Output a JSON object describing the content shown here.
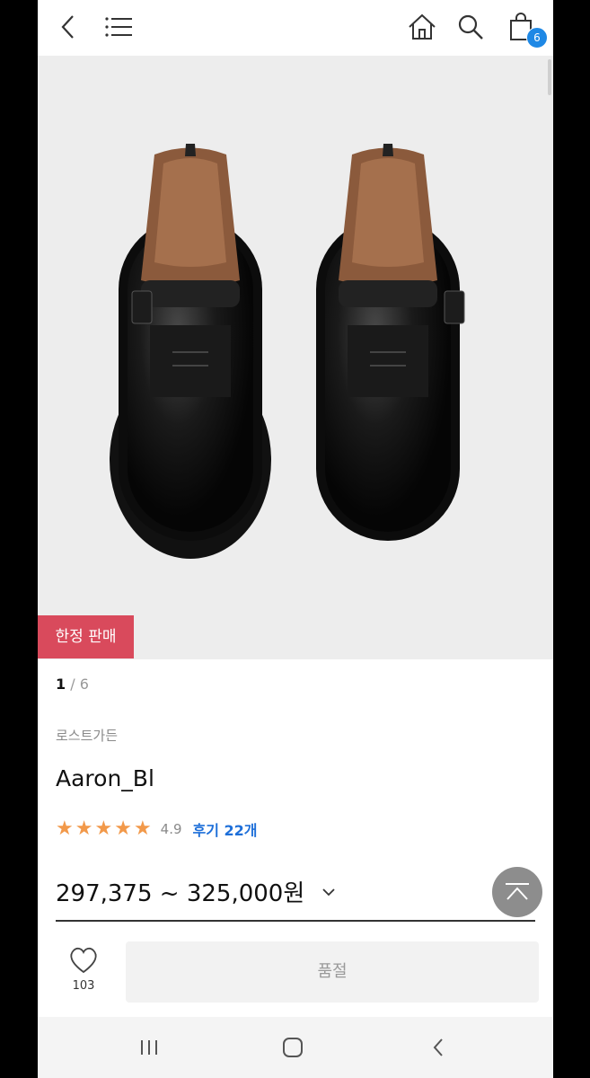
{
  "header": {
    "cart_count": "6",
    "icons": [
      "back-arrow-icon",
      "menu-icon",
      "home-icon",
      "search-icon",
      "shopping-bag-icon"
    ]
  },
  "hero": {
    "label_limited": "한정 판매",
    "page_current": "1",
    "page_sep": " / ",
    "page_total": "6"
  },
  "product": {
    "brand": "로스트가든",
    "name": "Aaron_Bl",
    "rating_stars": 5,
    "rating_score": "4.9",
    "reviews_label": "후기 22개",
    "price_range": "297,375 ~ 325,000원"
  },
  "actions": {
    "like_count": "103",
    "soldout_label": "품절"
  },
  "colors": {
    "accent_blue": "#1e6fd9",
    "badge_blue": "#1e88e5",
    "limited_red": "#d94a5c",
    "star_orange": "#f2994a"
  }
}
